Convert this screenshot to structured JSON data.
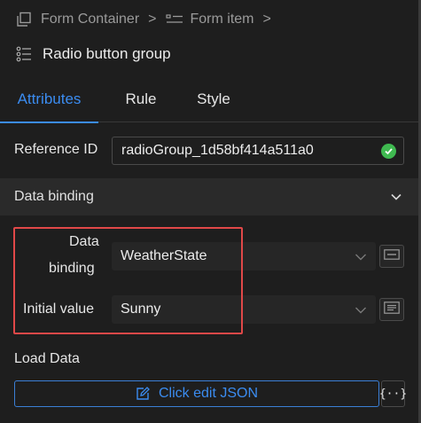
{
  "breadcrumb": {
    "items": [
      "Form Container",
      "Form item"
    ],
    "separator": ">"
  },
  "header": {
    "title": "Radio button group"
  },
  "tabs": [
    {
      "label": "Attributes",
      "active": true
    },
    {
      "label": "Rule",
      "active": false
    },
    {
      "label": "Style",
      "active": false
    }
  ],
  "reference": {
    "label": "Reference ID",
    "value": "radioGroup_1d58bf414a511a0"
  },
  "data_binding_section": {
    "title": "Data binding"
  },
  "fields": {
    "binding_label_line1": "Data",
    "binding_label_line2": "binding",
    "binding_value": "WeatherState",
    "initial_label": "Initial value",
    "initial_value": "Sunny"
  },
  "load_data": {
    "label": "Load Data",
    "button_label": "Click edit JSON",
    "braces": "{··}"
  },
  "colors": {
    "accent": "#3b8cf0",
    "highlight": "#e04848",
    "valid": "#3fb950"
  }
}
